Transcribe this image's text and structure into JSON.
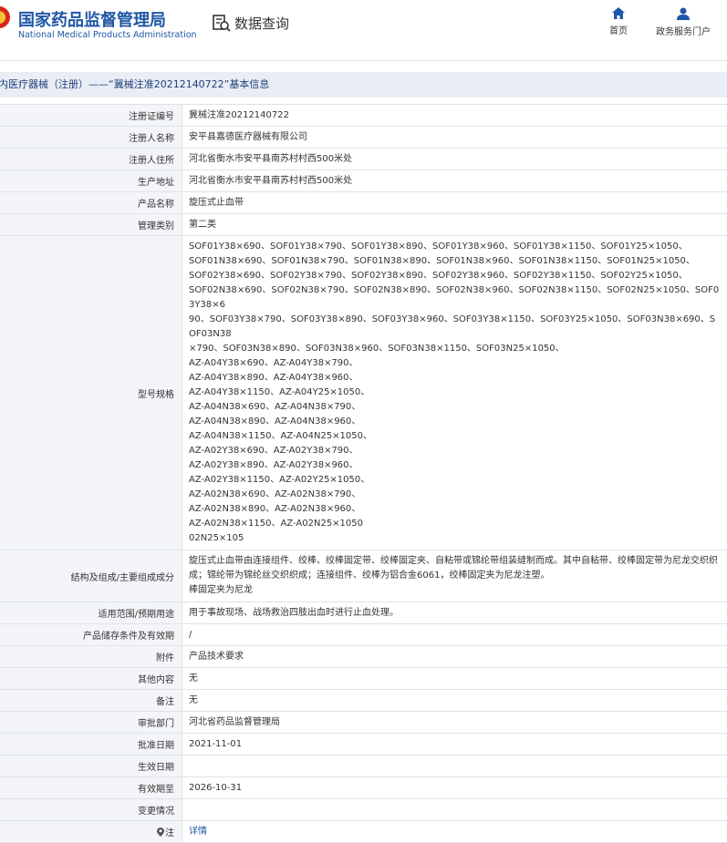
{
  "header": {
    "brand_cn": "国家药品监督管理局",
    "brand_en": "National Medical Products Administration",
    "query_label": "数据查询",
    "nav": [
      {
        "label": "首页",
        "icon": "home-icon"
      },
      {
        "label": "政务服务门户",
        "icon": "user-icon"
      }
    ]
  },
  "title": "内医疗器械（注册）——“冀械注准20212140722”基本信息",
  "rows": [
    {
      "label": "注册证编号",
      "value": "冀械注准20212140722"
    },
    {
      "label": "注册人名称",
      "value": "安平县嘉德医疗器械有限公司"
    },
    {
      "label": "注册人住所",
      "value": "河北省衡水市安平县南苏村村西500米处"
    },
    {
      "label": "生产地址",
      "value": "河北省衡水市安平县南苏村村西500米处"
    },
    {
      "label": "产品名称",
      "value": "旋压式止血带"
    },
    {
      "label": "管理类别",
      "value": "第二类"
    }
  ],
  "model": {
    "label": "型号规格",
    "lines": [
      "SOF01Y38×690、SOF01Y38×790、SOF01Y38×890、SOF01Y38×960、SOF01Y38×1150、SOF01Y25×1050、",
      "SOF01N38×690、SOF01N38×790、SOF01N38×890、SOF01N38×960、SOF01N38×1150、SOF01N25×1050、",
      "SOF02Y38×690、SOF02Y38×790、SOF02Y38×890、SOF02Y38×960、SOF02Y38×1150、SOF02Y25×1050、",
      "SOF02N38×690、SOF02N38×790、SOF02N38×890、SOF02N38×960、SOF02N38×1150、SOF02N25×1050、SOF03Y38×6",
      "90、SOF03Y38×790、SOF03Y38×890、SOF03Y38×960、SOF03Y38×1150、SOF03Y25×1050、SOF03N38×690、SOF03N38",
      "×790、SOF03N38×890、SOF03N38×960、SOF03N38×1150、SOF03N25×1050、",
      "AZ-A04Y38×690、AZ-A04Y38×790、",
      "AZ-A04Y38×890、AZ-A04Y38×960、",
      "AZ-A04Y38×1150、AZ-A04Y25×1050、",
      "AZ-A04N38×690、AZ-A04N38×790、",
      "AZ-A04N38×890、AZ-A04N38×960、",
      "AZ-A04N38×1150、AZ-A04N25×1050、",
      "AZ-A02Y38×690、AZ-A02Y38×790、",
      "AZ-A02Y38×890、AZ-A02Y38×960、",
      "AZ-A02Y38×1150、AZ-A02Y25×1050、",
      "AZ-A02N38×690、AZ-A02N38×790、",
      "AZ-A02N38×890、AZ-A02N38×960、",
      "AZ-A02N38×1150、AZ-A02N25×1050",
      "02N25×105"
    ]
  },
  "structure": {
    "label": "结构及组成/主要组成成分",
    "lines": [
      "旋压式止血带由连接组件、绞棒、绞棒固定带、绞棒固定夹、自粘带或锦纶带组装缝制而成。其中自粘带、绞棒固定带为尼龙交织织",
      "成；锦纶带为锦纶丝交织织成；连接组件、绞棒为铝合金6061，绞棒固定夹为尼龙注塑。",
      "棒固定夹为尼龙"
    ]
  },
  "rows2": [
    {
      "label": "适用范围/预期用途",
      "value": "用于事故现场、战场救治四肢出血时进行止血处理。"
    },
    {
      "label": "产品储存条件及有效期",
      "value": "/"
    },
    {
      "label": "附件",
      "value": "产品技术要求"
    },
    {
      "label": "其他内容",
      "value": "无"
    },
    {
      "label": "备注",
      "value": "无"
    },
    {
      "label": "审批部门",
      "value": "河北省药品监督管理局"
    },
    {
      "label": "批准日期",
      "value": "2021-11-01"
    },
    {
      "label": "生效日期",
      "value": ""
    },
    {
      "label": "有效期至",
      "value": "2026-10-31"
    },
    {
      "label": "变更情况",
      "value": ""
    }
  ],
  "note": {
    "label": "注",
    "value": "详情"
  }
}
